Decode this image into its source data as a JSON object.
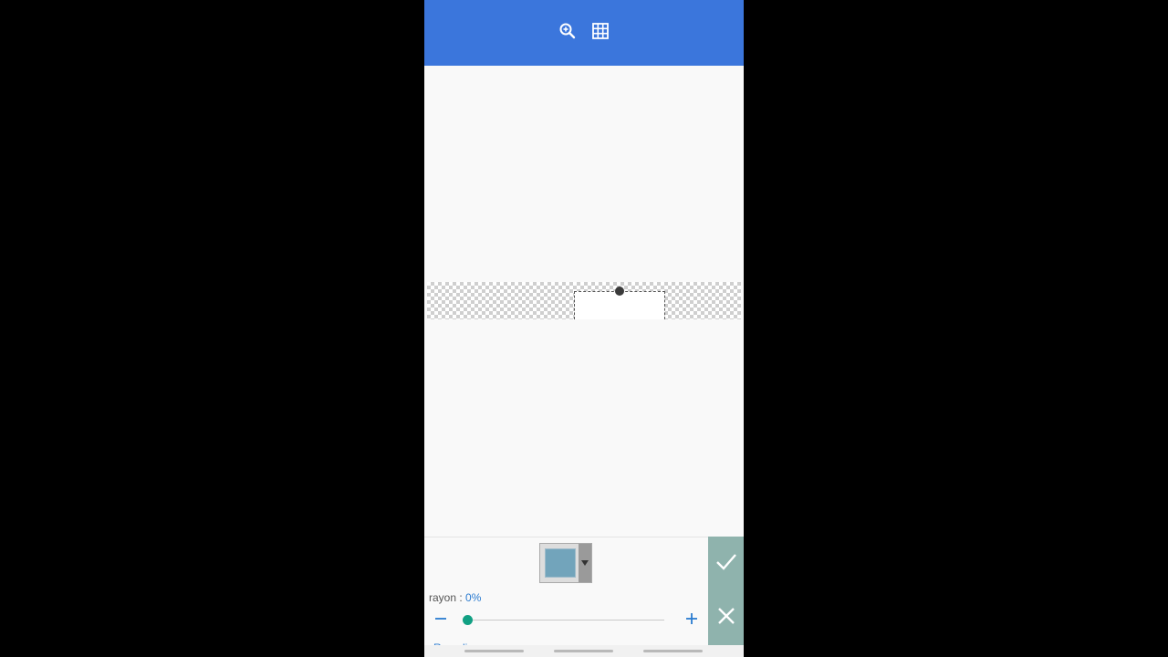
{
  "toolbar": {
    "icons": [
      "zoom-in-icon",
      "grid-icon"
    ],
    "color": "#3b76dc"
  },
  "editor": {
    "selected_color": "#72a4bb",
    "radius_label": "rayon :",
    "radius_value": "0%",
    "radius_level": 0,
    "fill_link_label": "Remplir",
    "accent_color": "#11a083"
  },
  "actions": {
    "confirm_icon": "check-icon",
    "cancel_icon": "close-icon",
    "color": "#8fb3ad"
  }
}
